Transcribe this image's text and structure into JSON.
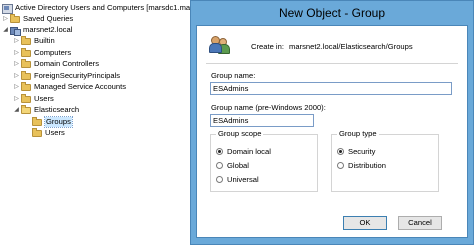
{
  "tree": {
    "root_label": "Active Directory Users and Computers [marsdc1.mar",
    "items": [
      {
        "label": "Saved Queries"
      },
      {
        "label": "marsnet2.local"
      },
      {
        "label": "Builtin"
      },
      {
        "label": "Computers"
      },
      {
        "label": "Domain Controllers"
      },
      {
        "label": "ForeignSecurityPrincipals"
      },
      {
        "label": "Managed Service Accounts"
      },
      {
        "label": "Users"
      },
      {
        "label": "Elasticsearch"
      },
      {
        "label": "Groups"
      },
      {
        "label": "Users"
      }
    ]
  },
  "dialog": {
    "title": "New Object - Group",
    "create_in_label": "Create in:",
    "create_in_value": "marsnet2.local/Elasticsearch/Groups",
    "group_name_label": "Group name:",
    "group_name_value": "ESAdmins",
    "group_name_pre2000_label": "Group name (pre-Windows 2000):",
    "group_name_pre2000_value": "ESAdmins",
    "group_scope": {
      "title": "Group scope",
      "options": [
        "Domain local",
        "Global",
        "Universal"
      ],
      "selected": "Domain local"
    },
    "group_type": {
      "title": "Group type",
      "options": [
        "Security",
        "Distribution"
      ],
      "selected": "Security"
    },
    "ok_label": "OK",
    "cancel_label": "Cancel"
  },
  "colors": {
    "frame": "#6aa9d9",
    "selection": "#cce8ff"
  }
}
